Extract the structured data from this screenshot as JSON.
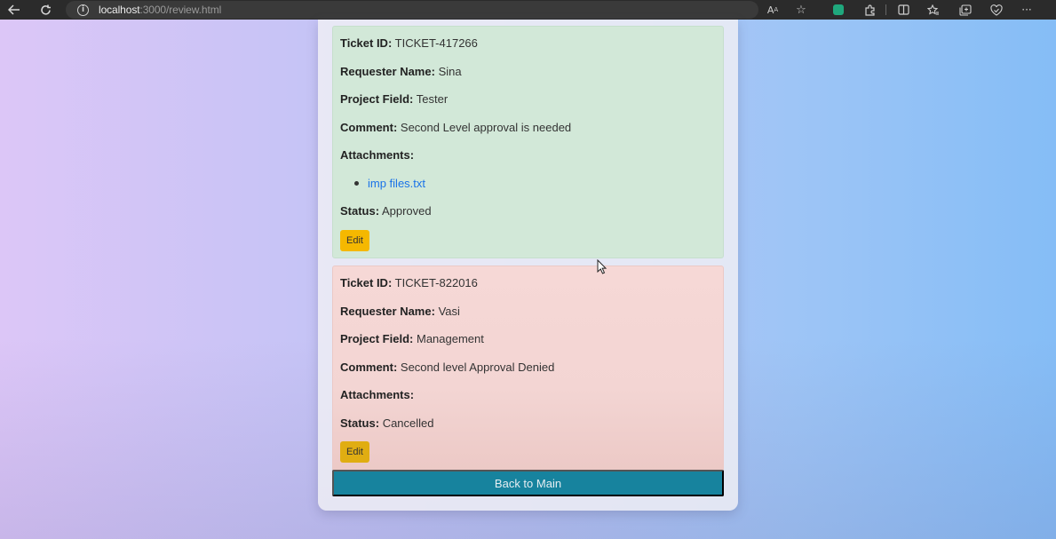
{
  "browser": {
    "url_host": "localhost",
    "url_rest": ":3000/review.html",
    "icons": [
      "back-arrow-icon",
      "refresh-icon",
      "info-icon",
      "read-aloud-icon",
      "favorite-star-icon",
      "extension-icon",
      "extensions-puzzle-icon",
      "split-screen-icon",
      "favorites-icon",
      "collections-icon",
      "browser-essentials-icon",
      "more-menu-icon"
    ]
  },
  "tickets": [
    {
      "status_color": "#d2e8d8",
      "ticket_id_label": "Ticket ID:",
      "ticket_id": "TICKET-417266",
      "requester_label": "Requester Name:",
      "requester": "Sina",
      "project_label": "Project Field:",
      "project": "Tester",
      "comment_label": "Comment:",
      "comment": "Second Level approval is needed",
      "attachments_label": "Attachments:",
      "attachments": [
        "imp files.txt"
      ],
      "status_label": "Status:",
      "status": "Approved",
      "edit_label": "Edit"
    },
    {
      "status_color": "#f6d8d6",
      "ticket_id_label": "Ticket ID:",
      "ticket_id": "TICKET-822016",
      "requester_label": "Requester Name:",
      "requester": "Vasi",
      "project_label": "Project Field:",
      "project": "Management",
      "comment_label": "Comment:",
      "comment": "Second level Approval Denied",
      "attachments_label": "Attachments:",
      "attachments": [],
      "status_label": "Status:",
      "status": "Cancelled",
      "edit_label": "Edit"
    }
  ],
  "back_button_label": "Back to Main",
  "colors": {
    "edit_button": "#f5b800",
    "back_button": "#17839e",
    "link": "#1a73e8"
  }
}
